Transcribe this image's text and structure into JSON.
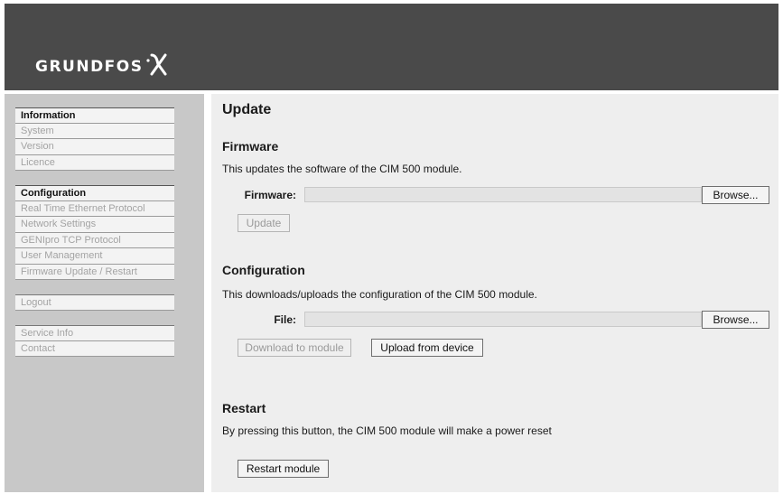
{
  "brand": {
    "logo_text": "GRUNDFOS"
  },
  "sidebar": {
    "information": {
      "heading": "Information",
      "items": [
        "System",
        "Version",
        "Licence"
      ]
    },
    "configuration": {
      "heading": "Configuration",
      "items": [
        "Real Time Ethernet Protocol",
        "Network Settings",
        "GENIpro TCP Protocol",
        "User Management",
        "Firmware Update / Restart"
      ]
    },
    "logout": "Logout",
    "support": {
      "items": [
        "Service Info",
        "Contact"
      ]
    }
  },
  "main": {
    "title": "Update",
    "firmware": {
      "heading": "Firmware",
      "description": "This updates the software of the CIM 500 module.",
      "field_label": "Firmware:",
      "field_value": "",
      "browse_label": "Browse...",
      "update_label": "Update"
    },
    "configuration": {
      "heading": "Configuration",
      "description": "This downloads/uploads the configuration of the CIM 500 module.",
      "field_label": "File:",
      "field_value": "",
      "browse_label": "Browse...",
      "download_label": "Download to module",
      "upload_label": "Upload from device"
    },
    "restart": {
      "heading": "Restart",
      "description": "By pressing this button, the CIM 500 module will make a power reset",
      "button_label": "Restart module"
    }
  }
}
